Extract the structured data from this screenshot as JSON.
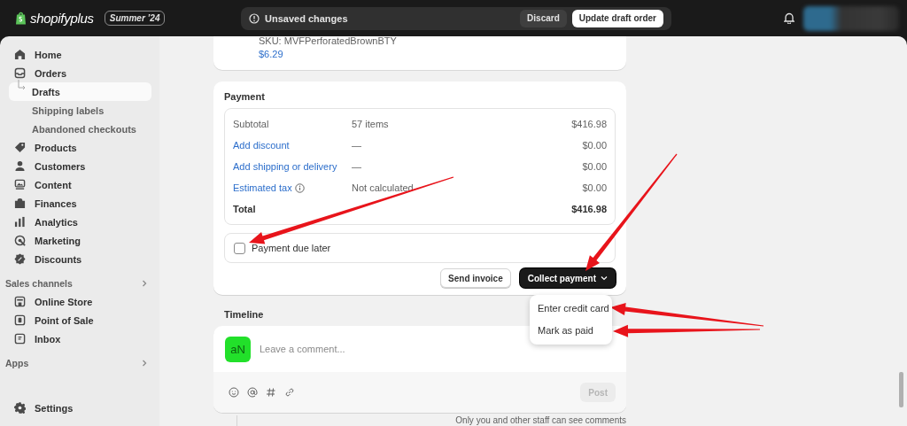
{
  "topbar": {
    "brand": "**shopify**plus",
    "badge": "Summer ’24",
    "save_bar": {
      "message": "Unsaved changes",
      "discard": "Discard",
      "save": "Update draft order"
    }
  },
  "sidebar": {
    "items": [
      {
        "label": "Home",
        "selected": false
      },
      {
        "label": "Orders",
        "selected": false,
        "children": [
          {
            "label": "Drafts",
            "selected": true
          },
          {
            "label": "Shipping labels",
            "selected": false
          },
          {
            "label": "Abandoned checkouts",
            "selected": false
          }
        ]
      },
      {
        "label": "Products",
        "selected": false
      },
      {
        "label": "Customers",
        "selected": false
      },
      {
        "label": "Content",
        "selected": false
      },
      {
        "label": "Finances",
        "selected": false
      },
      {
        "label": "Analytics",
        "selected": false
      },
      {
        "label": "Marketing",
        "selected": false
      },
      {
        "label": "Discounts",
        "selected": false
      }
    ],
    "sections": [
      {
        "title": "Sales channels",
        "items": [
          {
            "label": "Online Store",
            "selected": false
          },
          {
            "label": "Point of Sale",
            "selected": false
          },
          {
            "label": "Inbox",
            "selected": false
          }
        ]
      },
      {
        "title": "Apps"
      }
    ],
    "footer": {
      "label": "Settings",
      "selected": false
    }
  },
  "line_item": {
    "sku": "SKU: MVFPerforatedBrownBTY",
    "price": "$6.29"
  },
  "payment": {
    "title": "Payment",
    "rows": [
      {
        "kind": "text",
        "label": "Subtotal",
        "detail": "57 items",
        "amount": "$416.98"
      },
      {
        "kind": "link",
        "label": "Add discount",
        "detail": "—",
        "amount": "$0.00"
      },
      {
        "kind": "link",
        "label": "Add shipping or delivery",
        "detail": "—",
        "amount": "$0.00"
      },
      {
        "kind": "link-info",
        "label": "Estimated tax",
        "detail": "Not calculated",
        "amount": "$0.00"
      },
      {
        "kind": "total",
        "label": "Total",
        "amount": "$416.98"
      }
    ],
    "due_later": {
      "label": "Payment due later",
      "checked": false
    },
    "send_invoice": "Send invoice",
    "collect": {
      "label": "Collect payment",
      "expanded": true,
      "menu": [
        "Enter credit card",
        "Mark as paid"
      ]
    }
  },
  "timeline": {
    "title": "Timeline",
    "avatar": "aN",
    "placeholder": "Leave a comment...",
    "post": {
      "label": "Post",
      "disabled": true
    },
    "note": "Only you and other staff can see comments"
  },
  "annotations": [
    {
      "kind": "arrow"
    },
    {
      "kind": "arrow"
    },
    {
      "kind": "arrow"
    },
    {
      "kind": "arrow"
    }
  ]
}
